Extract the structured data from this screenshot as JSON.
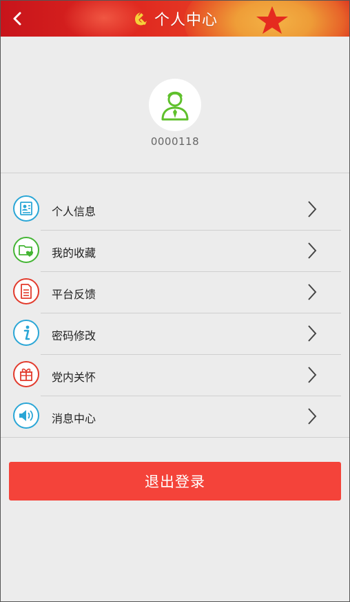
{
  "header": {
    "title": "个人中心",
    "back_icon": "chevron-left-icon",
    "emblem_icon": "hammer-sickle-icon"
  },
  "profile": {
    "avatar_icon": "user-avatar-icon",
    "user_id": "0000118"
  },
  "menu": {
    "items": [
      {
        "label": "个人信息",
        "icon": "contact-card-icon",
        "color": "#2aa6d6"
      },
      {
        "label": "我的收藏",
        "icon": "favorite-folder-icon",
        "color": "#44b534"
      },
      {
        "label": "平台反馈",
        "icon": "document-icon",
        "color": "#e23a2c"
      },
      {
        "label": "密码修改",
        "icon": "info-icon",
        "color": "#2aa6d6"
      },
      {
        "label": "党内关怀",
        "icon": "gift-icon",
        "color": "#e23a2c"
      },
      {
        "label": "消息中心",
        "icon": "speaker-icon",
        "color": "#2aa6d6"
      }
    ]
  },
  "actions": {
    "logout_label": "退出登录"
  },
  "colors": {
    "header": "#d9241c",
    "logout": "#f4433a",
    "background": "#ececec"
  }
}
